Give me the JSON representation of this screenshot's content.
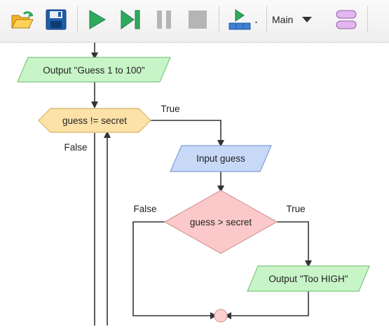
{
  "toolbar": {
    "buttons": [
      {
        "name": "open-folder-icon"
      },
      {
        "name": "save-icon"
      },
      {
        "name": "run-icon"
      },
      {
        "name": "step-icon"
      },
      {
        "name": "pause-icon"
      },
      {
        "name": "stop-icon"
      },
      {
        "name": "run-mode-icon"
      }
    ],
    "function_select": "Main",
    "colors": {
      "green": "#2eaa5e",
      "disabled": "#b5b5b5",
      "blue": "#1f5ea8",
      "purple": "#e2b6ee"
    }
  },
  "flowchart": {
    "output_greet": "Output \"Guess 1 to 100\"",
    "loop_condition": "guess != secret",
    "loop_true": "True",
    "loop_false": "False",
    "input": "Input guess",
    "if_condition": "guess > secret",
    "if_true": "True",
    "if_false": "False",
    "output_high": "Output \"Too HIGH\"",
    "colors": {
      "output_fill": "#c8f5c8",
      "output_stroke": "#7fc67f",
      "loop_fill": "#fde2a8",
      "loop_stroke": "#d6b46a",
      "input_fill": "#c8d9f8",
      "input_stroke": "#7f9fd6",
      "if_fill": "#fbc9c9",
      "if_stroke": "#d69a9a",
      "connector_fill": "#fcd0d0",
      "connector_stroke": "#d69a9a",
      "line": "#333333"
    }
  }
}
